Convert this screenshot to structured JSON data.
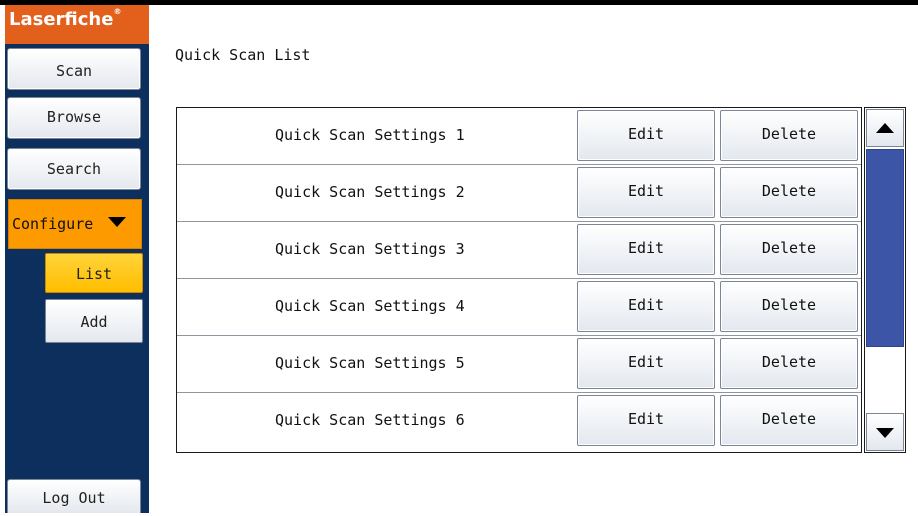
{
  "app": {
    "logo_text": "Laserfiche",
    "logo_mark": "®"
  },
  "sidebar": {
    "items": [
      {
        "label": "Scan"
      },
      {
        "label": "Browse"
      },
      {
        "label": "Search"
      }
    ],
    "configure": {
      "label": "Configure",
      "icon": "caret-down-icon",
      "subitems": [
        {
          "label": "List",
          "selected": true
        },
        {
          "label": "Add",
          "selected": false
        }
      ]
    },
    "logout_label": "Log Out"
  },
  "main": {
    "title": "Quick Scan List",
    "rows": [
      {
        "name": "Quick Scan Settings 1",
        "edit": "Edit",
        "delete": "Delete"
      },
      {
        "name": "Quick Scan Settings 2",
        "edit": "Edit",
        "delete": "Delete"
      },
      {
        "name": "Quick Scan Settings 3",
        "edit": "Edit",
        "delete": "Delete"
      },
      {
        "name": "Quick Scan Settings 4",
        "edit": "Edit",
        "delete": "Delete"
      },
      {
        "name": "Quick Scan Settings 5",
        "edit": "Edit",
        "delete": "Delete"
      },
      {
        "name": "Quick Scan Settings 6",
        "edit": "Edit",
        "delete": "Delete"
      }
    ],
    "scrollbar": {
      "up_icon": "scroll-up-arrow-icon",
      "down_icon": "scroll-down-arrow-icon"
    }
  },
  "colors": {
    "brand": "#e35f1c",
    "sidebar_bg": "#0c2f5d",
    "configure_accent": "#fc9a00",
    "selected_yellow": "#ffbd00",
    "scroll_thumb": "#3d55a6"
  }
}
